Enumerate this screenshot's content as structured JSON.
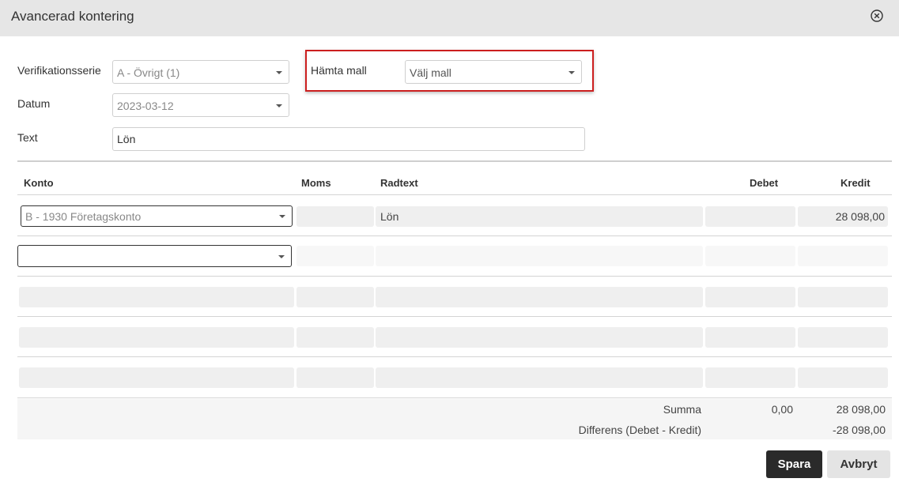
{
  "dialog": {
    "title": "Avancerad kontering"
  },
  "form": {
    "series_label": "Verifikationsserie",
    "series_value": "A - Övrigt (1)",
    "template_label": "Hämta mall",
    "template_value": "Välj mall",
    "date_label": "Datum",
    "date_value": "2023-03-12",
    "text_label": "Text",
    "text_value": "Lön"
  },
  "table": {
    "headers": {
      "konto": "Konto",
      "moms": "Moms",
      "radtext": "Radtext",
      "debet": "Debet",
      "kredit": "Kredit"
    },
    "rows": [
      {
        "konto": "B - 1930 Företagskonto",
        "moms": "",
        "radtext": "Lön",
        "debet": "",
        "kredit": "28 098,00"
      },
      {
        "konto": "",
        "moms": "",
        "radtext": "",
        "debet": "",
        "kredit": ""
      },
      {
        "konto": "",
        "moms": "",
        "radtext": "",
        "debet": "",
        "kredit": ""
      },
      {
        "konto": "",
        "moms": "",
        "radtext": "",
        "debet": "",
        "kredit": ""
      },
      {
        "konto": "",
        "moms": "",
        "radtext": "",
        "debet": "",
        "kredit": ""
      }
    ]
  },
  "summary": {
    "summa_label": "Summa",
    "summa_debet": "0,00",
    "summa_kredit": "28 098,00",
    "diff_label": "Differens (Debet - Kredit)",
    "diff_kredit": "-28 098,00"
  },
  "buttons": {
    "save": "Spara",
    "cancel": "Avbryt"
  },
  "colors": {
    "header_bg": "#e6e6e6",
    "highlight": "#cc1f1f",
    "primary_button": "#2a2a2a"
  },
  "icons": {
    "close": "close-circle-icon",
    "dropdown": "caret-down-icon"
  }
}
